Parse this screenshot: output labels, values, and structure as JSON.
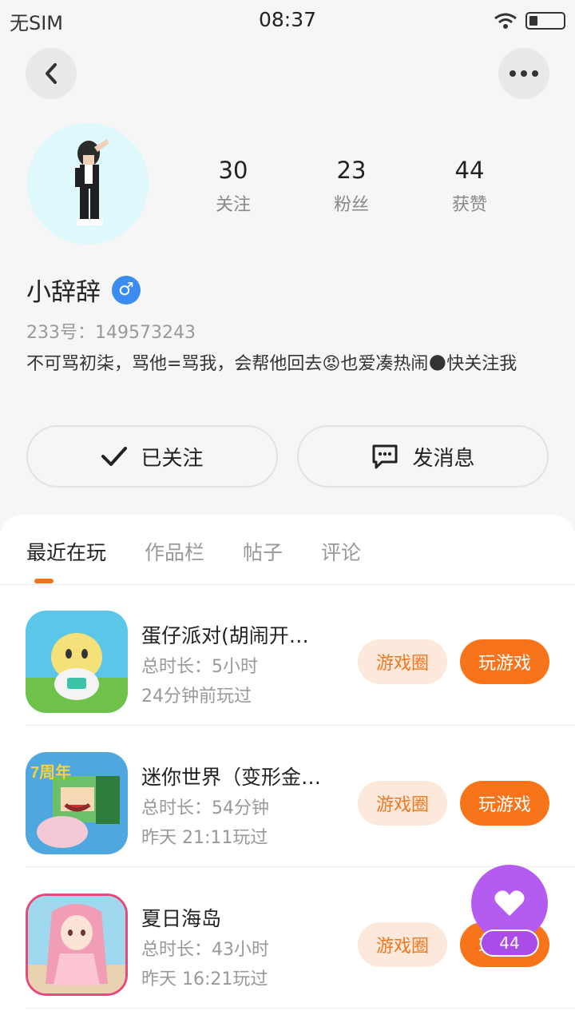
{
  "status_bar": {
    "carrier": "无SIM",
    "time": "08:37"
  },
  "header": {
    "back_icon": "chevron-left-icon",
    "more_icon": "more-dots-icon"
  },
  "profile": {
    "stats": [
      {
        "value": "30",
        "label": "关注"
      },
      {
        "value": "23",
        "label": "粉丝"
      },
      {
        "value": "44",
        "label": "获赞"
      }
    ],
    "username": "小辞辞",
    "gender_symbol": "♂",
    "uid": "233号：149573243",
    "bio": "不可骂初柒，骂他=骂我，会帮他回去😡也爱凑热闹🌑快关注我"
  },
  "actions": {
    "follow_label": "已关注",
    "message_label": "发消息"
  },
  "tabs": [
    {
      "label": "最近在玩",
      "active": true
    },
    {
      "label": "作品栏",
      "active": false
    },
    {
      "label": "帖子",
      "active": false
    },
    {
      "label": "评论",
      "active": false
    }
  ],
  "games": [
    {
      "name": "蛋仔派对(胡闹开…",
      "duration": "总时长：5小时",
      "last_played": "24分钟前玩过",
      "circle_label": "游戏圈",
      "play_label": "玩游戏"
    },
    {
      "name": "迷你世界（变形金…",
      "duration": "总时长：54分钟",
      "last_played": "昨天 21:11玩过",
      "circle_label": "游戏圈",
      "play_label": "玩游戏"
    },
    {
      "name": "夏日海岛",
      "duration": "总时长：43小时",
      "last_played": "昨天 16:21玩过",
      "circle_label": "游戏圈",
      "play_label": "玩游戏"
    }
  ],
  "game_icon_texts": [
    "7周年"
  ],
  "like_fab": {
    "icon": "heart-icon",
    "count": "44"
  },
  "colors": {
    "accent": "#f8741a",
    "accent_light": "#fde8dc",
    "like_purple": "#b55cf0",
    "gender_blue": "#3b8cf0"
  }
}
